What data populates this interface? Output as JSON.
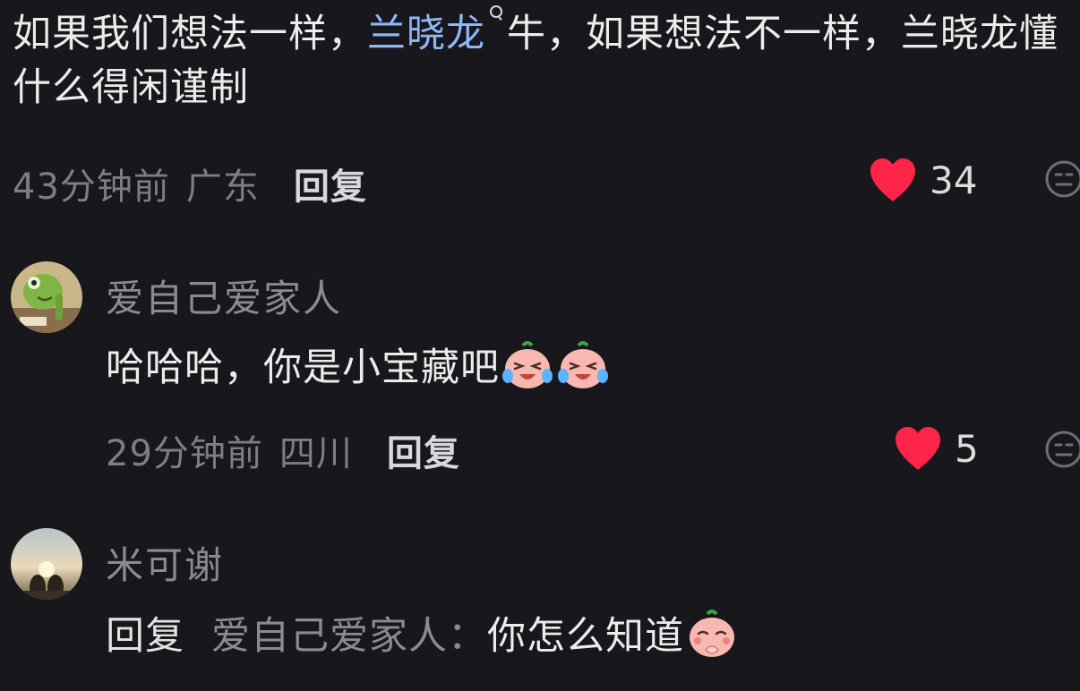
{
  "comments": [
    {
      "text_before_mention": "如果我们想法一样，",
      "mention": "兰晓龙",
      "text_after_mention": "牛，如果想法不一样，兰晓龙懂什么得闲谨制",
      "time": "43分钟前",
      "region": "广东",
      "reply_label": "回复",
      "likes": "34"
    },
    {
      "username": "爱自己爱家人",
      "text": "哈哈哈，你是小宝藏吧",
      "emoji": "crying-laughing-emoji",
      "emoji_count": 2,
      "time": "29分钟前",
      "region": "四川",
      "reply_label": "回复",
      "likes": "5"
    },
    {
      "username": "米可谢",
      "reply_prefix": "回复",
      "reply_target": "爱自己爱家人：",
      "text": "你怎么知道",
      "emoji": "shy-praying-emoji"
    }
  ],
  "colors": {
    "background": "#17171c",
    "mention": "#8fb6f5",
    "heart": "#ff2448",
    "meta": "#7d7d85"
  }
}
